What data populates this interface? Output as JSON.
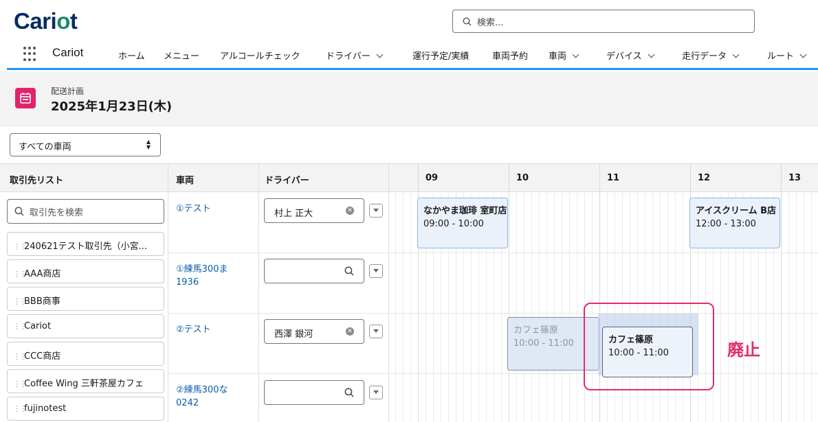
{
  "header": {
    "logo": "Cariot",
    "search_placeholder": "検索...",
    "app_name": "Cariot",
    "nav": [
      {
        "label": "ホーム",
        "chevron": false
      },
      {
        "label": "メニュー",
        "chevron": false
      },
      {
        "label": "アルコールチェック",
        "chevron": false
      },
      {
        "label": "ドライバー",
        "chevron": true
      },
      {
        "label": "運行予定/実績",
        "chevron": false
      },
      {
        "label": "車両予約",
        "chevron": false
      },
      {
        "label": "車両",
        "chevron": true
      },
      {
        "label": "デバイス",
        "chevron": true
      },
      {
        "label": "走行データ",
        "chevron": true
      },
      {
        "label": "ルート",
        "chevron": true
      }
    ]
  },
  "page": {
    "subtitle": "配送計画",
    "title": "2025年1月23日(木)",
    "vehicle_filter": "すべての車両"
  },
  "columns": {
    "clients": "取引先リスト",
    "vehicle": "車両",
    "driver": "ドライバー",
    "hours": [
      "09",
      "10",
      "11",
      "12",
      "13"
    ]
  },
  "client_search_placeholder": "取引先を検索",
  "clients": [
    "240621テスト取引先（小宮...",
    "AAA商店",
    "BBB商事",
    "Cariot",
    "CCC商店",
    "Coffee Wing 三軒茶屋カフェ",
    "fujinotest"
  ],
  "rows": [
    {
      "vehicle": "①テスト",
      "driver": "村上 正大"
    },
    {
      "vehicle_line1": "①練馬300ま",
      "vehicle_line2": "1936",
      "driver": ""
    },
    {
      "vehicle": "②テスト",
      "driver": "西澤 銀河"
    },
    {
      "vehicle_line1": "②練馬300な",
      "vehicle_line2": "0242",
      "driver": ""
    }
  ],
  "events": [
    {
      "title": "なかやま珈琲 室町店",
      "time": "09:00 - 10:00"
    },
    {
      "title": "アイスクリーム B店",
      "time": "12:00 - 13:00"
    },
    {
      "title": "カフェ篠原",
      "time": "10:00 - 11:00"
    },
    {
      "title": "カフェ篠原",
      "time": "10:00 - 11:00"
    }
  ],
  "annotation": "廃止",
  "colors": {
    "brand": "#032d60",
    "accent": "#1b96ff",
    "annotation": "#e5296f",
    "icon_bg": "#e3226c"
  }
}
